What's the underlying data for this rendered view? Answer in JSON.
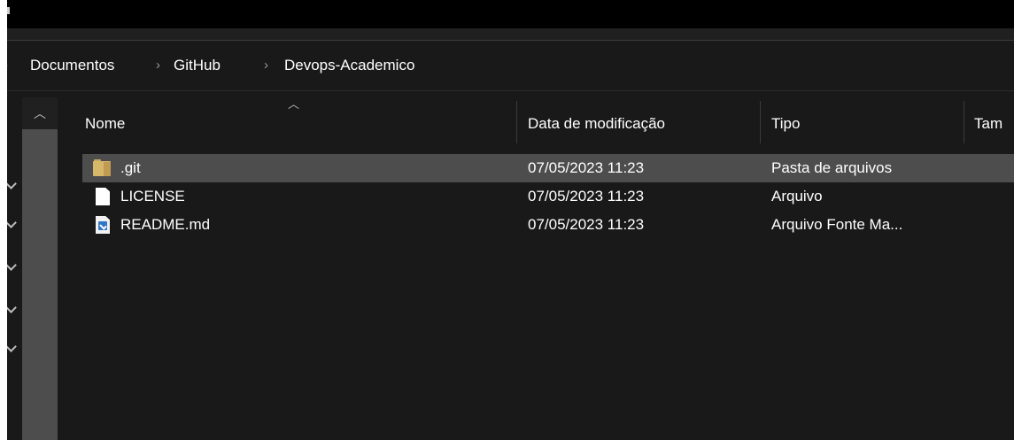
{
  "breadcrumb": {
    "items": [
      "Documentos",
      "GitHub",
      "Devops-Academico"
    ]
  },
  "columns": {
    "name": "Nome",
    "modified": "Data de modificação",
    "type": "Tipo",
    "size": "Tam"
  },
  "files": [
    {
      "name": ".git",
      "modified": "07/05/2023 11:23",
      "type": "Pasta de arquivos",
      "icon": "folder-icon",
      "selected": true
    },
    {
      "name": "LICENSE",
      "modified": "07/05/2023 11:23",
      "type": "Arquivo",
      "icon": "file-icon",
      "selected": false
    },
    {
      "name": "README.md",
      "modified": "07/05/2023 11:23",
      "type": "Arquivo Fonte Ma...",
      "icon": "markdown-file-icon",
      "selected": false
    }
  ],
  "colors": {
    "background": "#191919",
    "selection": "#4d4d4d",
    "folder": "#d7b76a"
  }
}
